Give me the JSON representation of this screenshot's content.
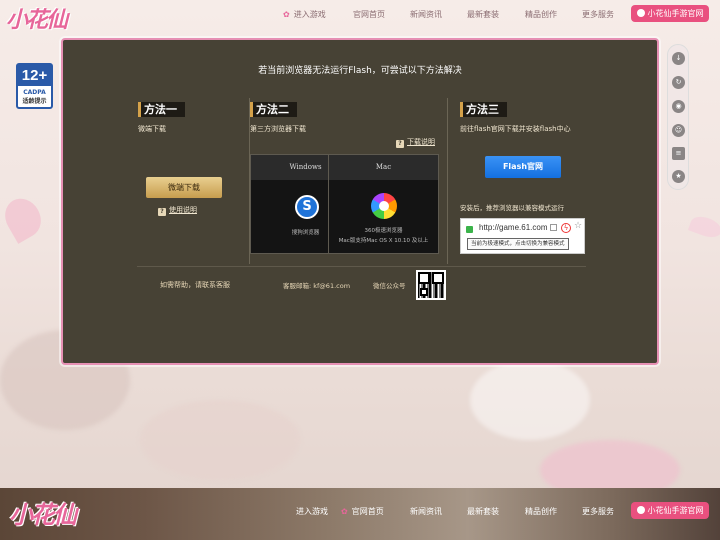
{
  "logo_text": "小花仙",
  "top_nav": {
    "items": [
      {
        "label": "进入游戏",
        "active": true
      },
      {
        "label": "官网首页"
      },
      {
        "label": "新闻资讯"
      },
      {
        "label": "最新套装"
      },
      {
        "label": "精品创作"
      },
      {
        "label": "更多服务"
      }
    ],
    "mobile_button": "小花仙手游官网"
  },
  "age_badge": {
    "age": "12+",
    "org": "CADPA",
    "tip": "适龄提示"
  },
  "panel": {
    "title": "若当前浏览器无法运行Flash，可尝试以下方法解决",
    "method1": {
      "heading": "方法一",
      "subtitle": "微端下载",
      "button": "微端下载",
      "help_link": "使用说明"
    },
    "method2": {
      "heading": "方法二",
      "subtitle": "第三方浏览器下载",
      "download_link": "下载说明",
      "browsers": [
        {
          "os": "Windows",
          "name": "搜狗浏览器",
          "note": ""
        },
        {
          "os": "Mac",
          "name": "360极速浏览器",
          "note": "Mac版支持Mac OS X 10.10 及以上"
        }
      ]
    },
    "method3": {
      "heading": "方法三",
      "subtitle": "前往flash官网下载并安装flash中心",
      "button": "Flash官网",
      "after_install": "安装后，推荐浏览器以兼容模式运行",
      "demo_url": "http://game.61.com",
      "demo_tooltip": "当前为极速模式，点击切换为兼容模式"
    },
    "help_text": "如需帮助，请联系客服",
    "email": "客服邮箱: kf@61.com",
    "wechat": "微信公众号"
  },
  "side_tools": [
    "download-icon",
    "refresh-icon",
    "screenshot-icon",
    "service-icon",
    "note-icon",
    "favorite-icon"
  ],
  "bottom_nav": {
    "items": [
      {
        "label": "进入游戏"
      },
      {
        "label": "官网首页",
        "active": true
      },
      {
        "label": "新闻资讯"
      },
      {
        "label": "最新套装"
      },
      {
        "label": "精品创作"
      },
      {
        "label": "更多服务"
      }
    ],
    "mobile_button": "小花仙手游官网"
  }
}
